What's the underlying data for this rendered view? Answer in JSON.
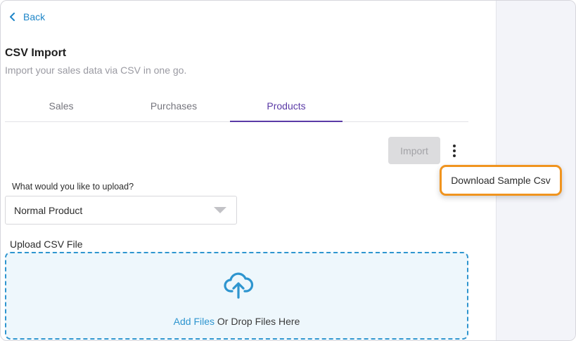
{
  "nav": {
    "back_label": "Back"
  },
  "header": {
    "title": "CSV Import",
    "subtitle": "Import your sales data via CSV in one go."
  },
  "tabs": [
    {
      "label": "Sales",
      "active": false
    },
    {
      "label": "Purchases",
      "active": false
    },
    {
      "label": "Products",
      "active": true
    }
  ],
  "actions": {
    "import_label": "Import",
    "import_disabled": true,
    "menu_items": [
      "Download Sample Csv"
    ]
  },
  "form": {
    "upload_type_label": "What would you like to upload?",
    "upload_type_value": "Normal Product",
    "upload_file_label": "Upload CSV File",
    "add_files_label": "Add Files",
    "drop_files_label": " Or Drop Files Here"
  },
  "colors": {
    "accent_tab": "#5a3aa6",
    "link_blue": "#2e95cf",
    "highlight_orange": "#f0941f"
  },
  "icons": {
    "back": "chevron-left-icon",
    "more": "kebab-menu-icon",
    "dropdown": "caret-down-icon",
    "upload": "cloud-upload-icon"
  }
}
